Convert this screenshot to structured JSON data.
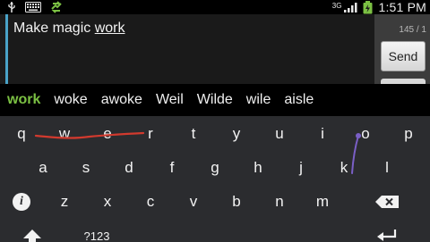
{
  "status_bar": {
    "time": "1:51 PM",
    "network": "3G",
    "icons": [
      "usb-icon",
      "keyboard-icon",
      "sync-icon",
      "signal-icon",
      "battery-charging-icon"
    ]
  },
  "compose": {
    "text_plain": "Make magic ",
    "text_composing": "work",
    "counter": "145 / 1",
    "send_label": "Send"
  },
  "suggestions": [
    "work",
    "woke",
    "awoke",
    "Weil",
    "Wilde",
    "wile",
    "aisle"
  ],
  "keyboard": {
    "row1": [
      "q",
      "w",
      "e",
      "r",
      "t",
      "y",
      "u",
      "i",
      "o",
      "p"
    ],
    "row2": [
      "a",
      "s",
      "d",
      "f",
      "g",
      "h",
      "j",
      "k",
      "l"
    ],
    "row3": [
      "z",
      "x",
      "c",
      "v",
      "b",
      "n",
      "m"
    ],
    "symbols_label": "?123",
    "icons": [
      "info-icon",
      "backspace-icon",
      "shift-icon",
      "enter-icon"
    ],
    "trail_colors": {
      "red": "#d23a2e",
      "purple": "#7a5fc6"
    }
  }
}
